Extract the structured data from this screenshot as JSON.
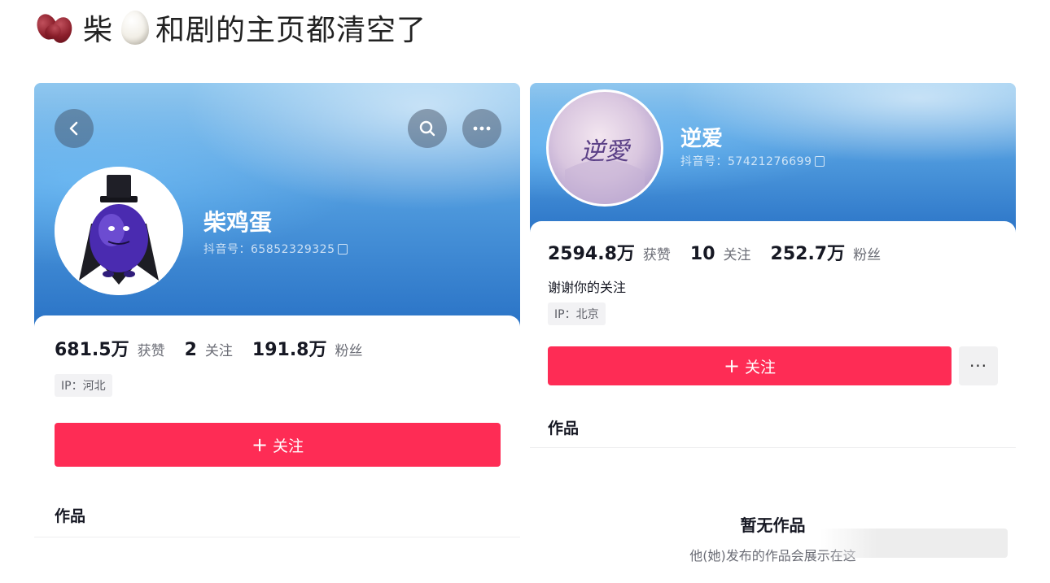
{
  "post": {
    "title_part1": "柴",
    "title_part2": "和剧的主页都清空了",
    "emoji_1": "beans-emoji",
    "emoji_2": "egg-emoji"
  },
  "left_profile": {
    "name": "柴鸡蛋",
    "douyin_id": "抖音号：65852329325",
    "likes_num": "681.5万",
    "likes_label": "获赞",
    "following_num": "2",
    "following_label": "关注",
    "followers_num": "191.8万",
    "followers_label": "粉丝",
    "ip": "IP：河北",
    "follow_button": "关注",
    "works_tab": "作品",
    "icons": [
      "back-icon",
      "search-icon",
      "more-icon"
    ]
  },
  "right_profile": {
    "name": "逆爱",
    "avatar_text": "逆愛",
    "douyin_id": "抖音号：57421276699",
    "likes_num": "2594.8万",
    "likes_label": "获赞",
    "following_num": "10",
    "following_label": "关注",
    "followers_num": "252.7万",
    "followers_label": "粉丝",
    "bio": "谢谢你的关注",
    "ip": "IP：北京",
    "follow_button": "关注",
    "more_button": "···",
    "works_tab": "作品",
    "empty_title": "暂无作品",
    "empty_subtitle": "他(她)发布的作品会展示在这"
  },
  "colors": {
    "accent_red": "#fe2c55",
    "header_blue": "#4d98dc"
  }
}
